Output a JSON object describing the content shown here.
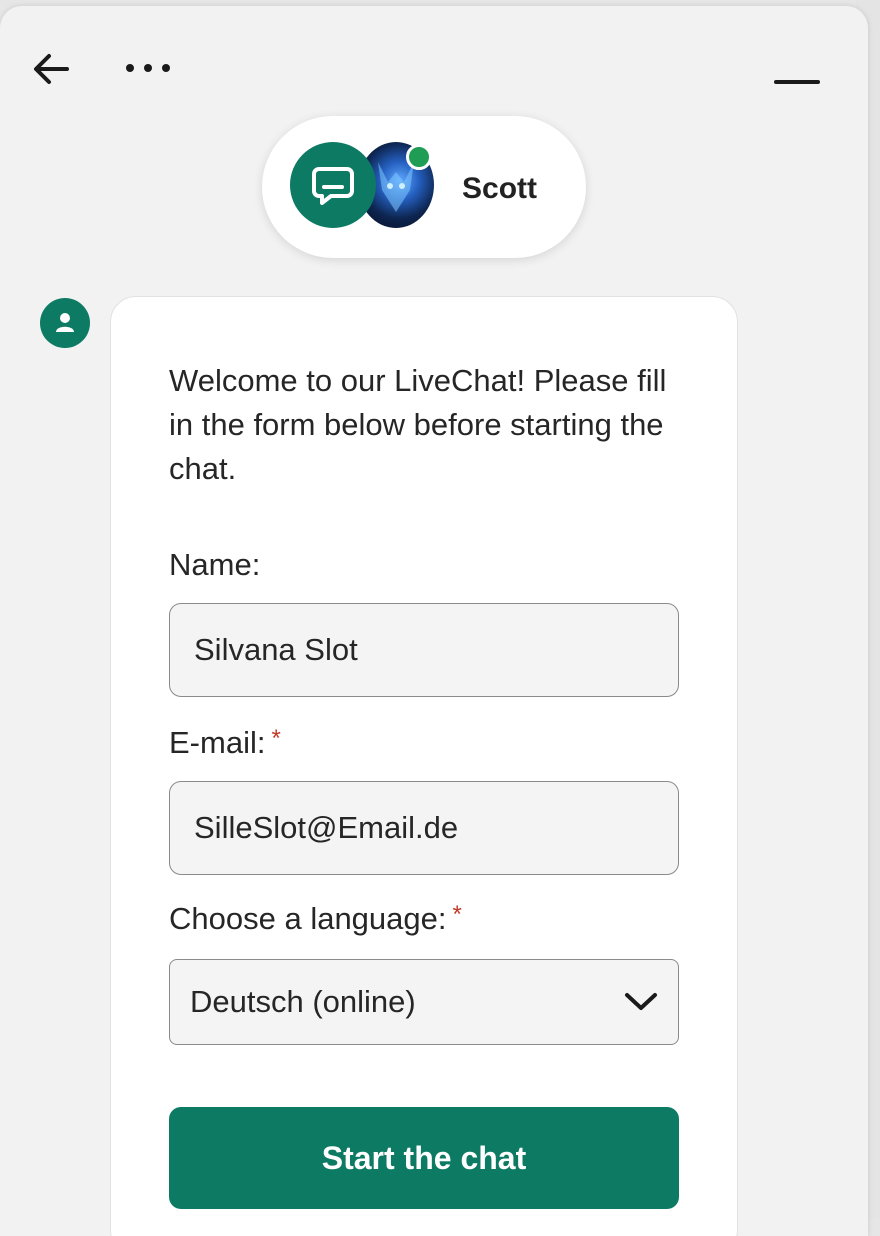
{
  "header": {
    "agent_name": "Scott",
    "agent_status": "online",
    "icons": {
      "back": "arrow-left-icon",
      "more": "more-horizontal-icon",
      "minimize": "minimize-icon",
      "chat": "chat-bubble-icon",
      "bot": "user-icon"
    }
  },
  "form": {
    "welcome_text": "Welcome to our LiveChat! Please fill in the form below before starting the chat.",
    "name_label": "Name:",
    "name_value": "Silvana Slot",
    "email_label": "E-mail:",
    "email_value": "SilleSlot@Email.de",
    "language_label": "Choose a language:",
    "language_value": "Deutsch (online)",
    "required_marker": "*",
    "submit_label": "Start the chat"
  },
  "colors": {
    "accent": "#0d7a64",
    "online": "#1f9d55",
    "required": "#c0392b"
  }
}
